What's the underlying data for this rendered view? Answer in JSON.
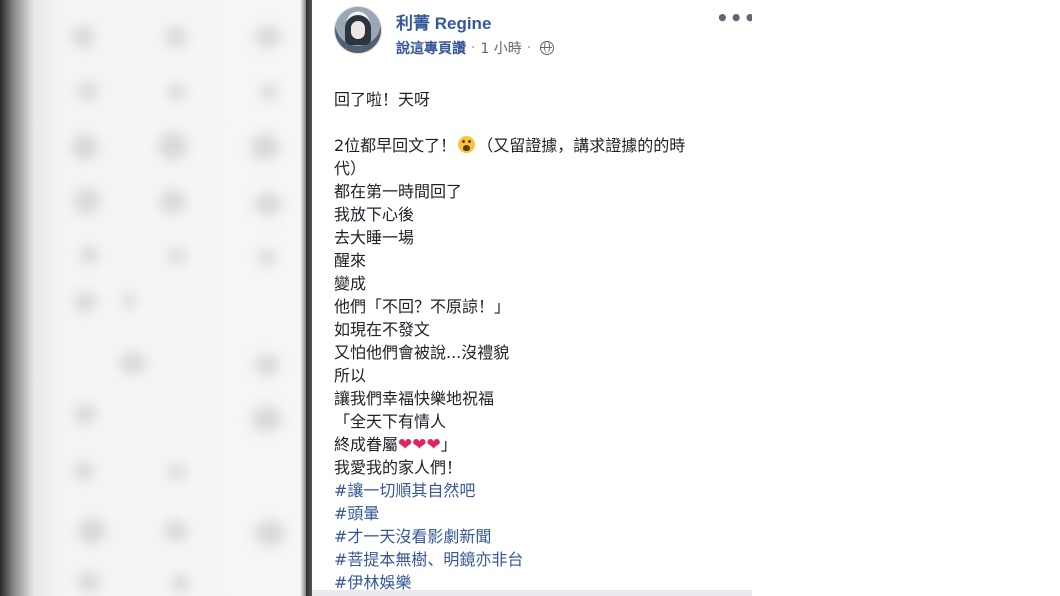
{
  "post": {
    "author": "利菁 Regine",
    "meta_action": "說這專頁讚",
    "separator": "·",
    "time": "1 小時",
    "more_label": "•••",
    "lines": [
      "回了啦！天呀",
      "",
      "2位都早回文了！",
      "（又留證據，講求證據的的時",
      "代）",
      "都在第一時間回了",
      "我放下心後",
      "去大睡一場",
      "醒來",
      "變成",
      "他們「不回？不原諒！」",
      "如現在不發文",
      "又怕他們會被說...沒禮貌",
      "所以",
      "讓我們幸福快樂地祝福",
      "「全天下有情人",
      "終成眷屬",
      "」",
      "我愛我的家人們！"
    ],
    "hearts": "❤❤❤",
    "hashtags": [
      "#讓一切順其自然吧",
      "#頭暈",
      "#才一天沒看影劇新聞",
      "#菩提本無樹、明鏡亦非台",
      "#伊林娛樂"
    ]
  },
  "colors": {
    "link": "#365899",
    "text": "#1d2129",
    "meta": "#616770"
  },
  "icons": [
    "avatar",
    "globe-icon",
    "more-icon",
    "crying-emoji-icon",
    "heart-icon"
  ]
}
